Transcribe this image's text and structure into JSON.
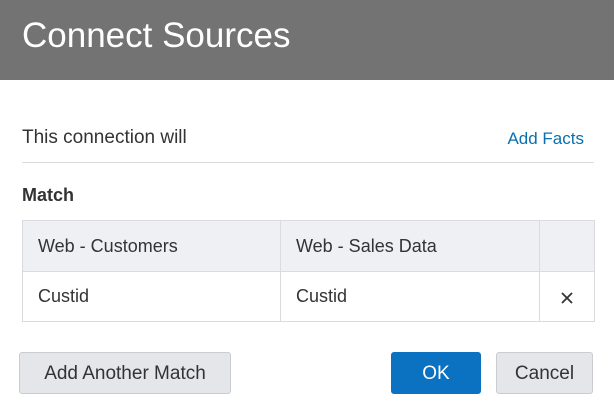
{
  "dialog": {
    "title": "Connect Sources"
  },
  "connection": {
    "label": "This connection will",
    "add_facts_link": "Add Facts"
  },
  "match": {
    "heading": "Match",
    "columns": [
      "Web - Customers",
      "Web - Sales Data"
    ],
    "rows": [
      {
        "left": "Custid",
        "right": "Custid",
        "remove_icon": "close-icon"
      }
    ]
  },
  "buttons": {
    "add_another_match": "Add Another Match",
    "ok": "OK",
    "cancel": "Cancel"
  },
  "colors": {
    "title_bar": "#737373",
    "link": "#0a6fb0",
    "primary": "#0a72c0",
    "header_cell": "#eef0f4"
  }
}
